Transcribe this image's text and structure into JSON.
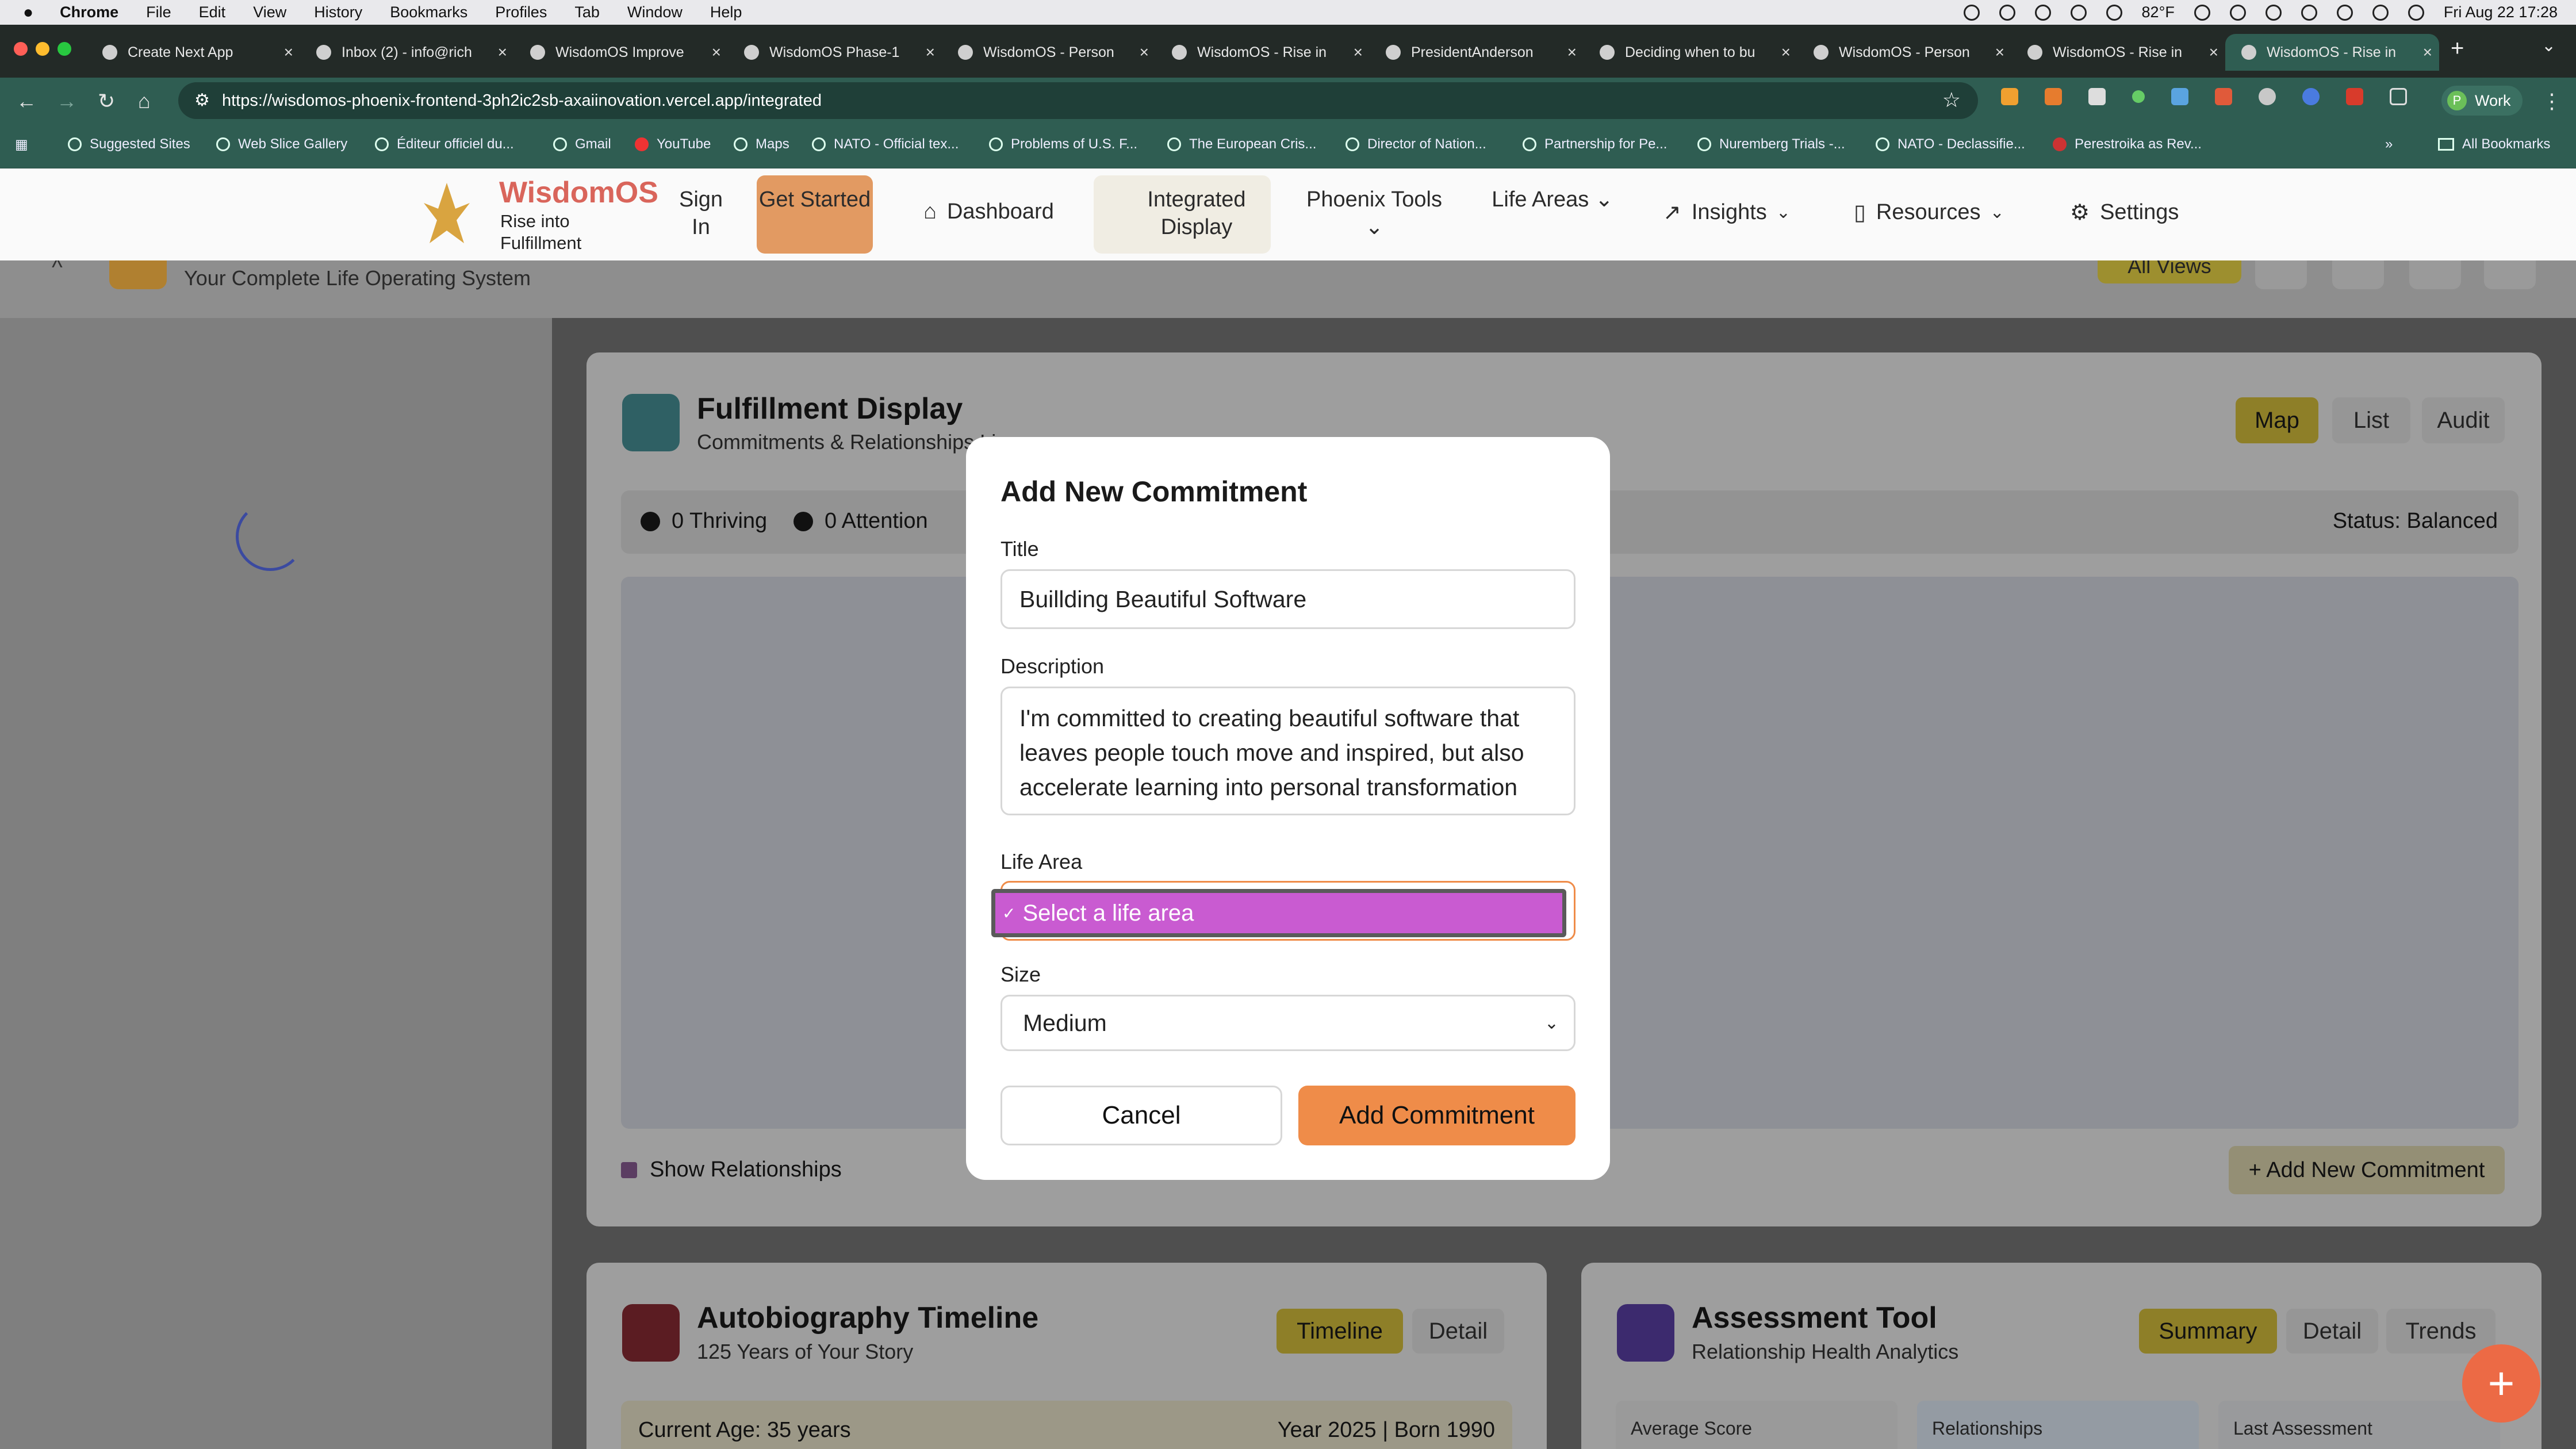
{
  "menubar": {
    "app": "Chrome",
    "menus": [
      "File",
      "Edit",
      "View",
      "History",
      "Bookmarks",
      "Profiles",
      "Tab",
      "Window",
      "Help"
    ],
    "temperature": "82°F",
    "datetime": "Fri Aug 22  17:28"
  },
  "tabs": [
    {
      "label": "Create Next App"
    },
    {
      "label": "Inbox (2) - info@rich"
    },
    {
      "label": "WisdomOS Improve"
    },
    {
      "label": "WisdomOS Phase-1"
    },
    {
      "label": "WisdomOS - Person"
    },
    {
      "label": "WisdomOS - Rise in"
    },
    {
      "label": "PresidentAnderson"
    },
    {
      "label": "Deciding when to bu"
    },
    {
      "label": "WisdomOS - Person"
    },
    {
      "label": "WisdomOS - Rise in"
    },
    {
      "label": "WisdomOS - Rise in"
    }
  ],
  "address": {
    "url": "https://wisdomos-phoenix-frontend-3ph2ic2sb-axaiinovation.vercel.app/integrated",
    "profile": "Work"
  },
  "bookmarks": [
    "Suggested Sites",
    "Web Slice Gallery",
    "Éditeur officiel du...",
    "Gmail",
    "YouTube",
    "Maps",
    "NATO - Official tex...",
    "Problems of U.S. F...",
    "The European Cris...",
    "Director of Nation...",
    "Partnership for Pe...",
    "Nuremberg Trials -...",
    "NATO - Declassifie...",
    "Perestroika as Rev..."
  ],
  "all_bookmarks": "All Bookmarks",
  "site": {
    "brand": "WisdomOS",
    "tagline1": "Rise into",
    "tagline2": "Fulfillment",
    "signin": "Sign In",
    "get_started": "Get Started",
    "nav": [
      "Dashboard",
      "Integrated Display",
      "Phoenix Tools",
      "Life Areas",
      "Insights",
      "Resources",
      "Settings"
    ],
    "subtitle": "Your Complete Life Operating System",
    "all_views": "All Views"
  },
  "fulfillment": {
    "title": "Fulfillment Display",
    "subtitle": "Commitments & Relationships Li",
    "views": [
      "Map",
      "List",
      "Audit"
    ],
    "stats": [
      "0 Thriving",
      "0 Attention"
    ],
    "status": "Status: Balanced",
    "show_relationships": "Show Relationships",
    "add_new": "+ Add New Commitment"
  },
  "timeline": {
    "title": "Autobiography Timeline",
    "subtitle": "125 Years of Your Story",
    "tabs": [
      "Timeline",
      "Detail"
    ],
    "age": "Current Age: 35 years",
    "year": "Year 2025 | Born 1990"
  },
  "assessment": {
    "title": "Assessment Tool",
    "subtitle": "Relationship Health Analytics",
    "tabs": [
      "Summary",
      "Detail",
      "Trends"
    ],
    "cols": [
      "Average Score",
      "Relationships",
      "Last Assessment"
    ]
  },
  "modal": {
    "title": "Add New Commitment",
    "title_label": "Title",
    "title_value": "Buillding Beautiful Software",
    "description_label": "Description",
    "description_value": "I'm committed to creating beautiful software that leaves people touch move and inspired, but also accelerate learning into personal transformation",
    "life_area_label": "Life Area",
    "life_area_option": "Select a life area",
    "size_label": "Size",
    "size_value": "Medium",
    "cancel": "Cancel",
    "submit": "Add Commitment"
  },
  "colors": {
    "accent": "#ef8c49",
    "highlight": "#c95bd1",
    "yellow": "#e8c53a"
  }
}
